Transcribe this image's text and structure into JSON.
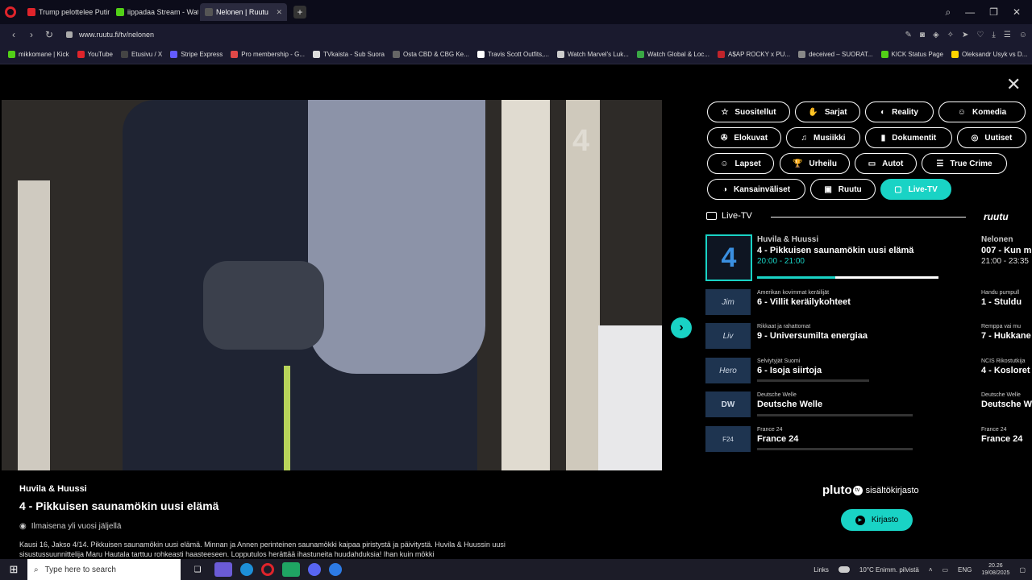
{
  "browser": {
    "tabs": [
      {
        "label": "Trump pelottelee Putinia |",
        "color": "#e0242b",
        "active": false
      },
      {
        "label": "iippadaa Stream - Watch",
        "color": "#52d017",
        "active": false
      },
      {
        "label": "Nelonen | Ruutu",
        "color": "#555555",
        "active": true
      }
    ],
    "new_tab": "+",
    "url": "www.ruutu.fi/tv/nelonen",
    "bookmarks": [
      {
        "label": "mikkomane | Kick",
        "color": "#52d017"
      },
      {
        "label": "YouTube",
        "color": "#e0242b"
      },
      {
        "label": "Etusivu / X",
        "color": "#444444"
      },
      {
        "label": "Stripe Express",
        "color": "#635bff"
      },
      {
        "label": "Pro membership - G...",
        "color": "#e04848"
      },
      {
        "label": "TVkaista - Sub Suora",
        "color": "#dddddd"
      },
      {
        "label": "Osta CBD & CBG Ke...",
        "color": "#666666"
      },
      {
        "label": "Travis Scott Outfits,...",
        "color": "#ffffff"
      },
      {
        "label": "Watch Marvel's Luk...",
        "color": "#cccccc"
      },
      {
        "label": "Watch Global & Loc...",
        "color": "#3aa845"
      },
      {
        "label": "A$AP ROCKY x PU...",
        "color": "#c0242b"
      },
      {
        "label": "deceived – SUORAT...",
        "color": "#888888"
      },
      {
        "label": "KICK Status Page",
        "color": "#52d017"
      },
      {
        "label": "Oleksandr Usyk vs D...",
        "color": "#ffd400"
      }
    ]
  },
  "player": {
    "channel_watermark": "4",
    "show": "Huvila & Huussi",
    "episode": "4 - Pikkuisen saunamökin uusi elämä",
    "availability": "Ilmaisena yli vuosi jäljellä",
    "description": "Kausi 16, Jakso 4/14. Pikkuisen saunamökin uusi elämä. Minnan ja Annen perinteinen saunamökki kaipaa piristystä ja päivitystä. Huvila & Huussin uusi sisustussuunnittelija Maru Hautala tarttuu rohkeasti haasteeseen. Lopputulos herättää ihastuneita huudahduksia! Ihan kuin mökki"
  },
  "categories": [
    {
      "label": "Suositellut",
      "icon": "☆"
    },
    {
      "label": "Sarjat",
      "icon": "✋"
    },
    {
      "label": "Reality",
      "icon": "◐"
    },
    {
      "label": "Komedia",
      "icon": "☺"
    },
    {
      "label": "Elokuvat",
      "icon": "✇"
    },
    {
      "label": "Musiikki",
      "icon": "♫"
    },
    {
      "label": "Dokumentit",
      "icon": "▮"
    },
    {
      "label": "Uutiset",
      "icon": "◎"
    },
    {
      "label": "Lapset",
      "icon": "☺"
    },
    {
      "label": "Urheilu",
      "icon": "🏆"
    },
    {
      "label": "Autot",
      "icon": "▭"
    },
    {
      "label": "True Crime",
      "icon": "☰"
    },
    {
      "label": "Kansainväliset",
      "icon": "◑"
    },
    {
      "label": "Ruutu",
      "icon": "▣"
    },
    {
      "label": "Live-TV",
      "icon": "▢"
    }
  ],
  "live": {
    "heading": "Live-TV",
    "ruutu_logo": "ruutu",
    "channels": [
      {
        "logo": "4",
        "sub": "Huvila & Huussi",
        "title": "4 - Pikkuisen saunamökin uusi elämä",
        "time": "20:00 - 21:00",
        "progress": 0.43
      },
      {
        "logo": "Jim",
        "sub": "Amerikan kovimmat keräilijät",
        "title": "6 - Villit keräilykohteet",
        "time": "",
        "progress": 0.0
      },
      {
        "logo": "Liv",
        "sub": "Rikkaat ja rahattomat",
        "title": "9 - Universumilta energiaa",
        "time": "",
        "progress": 0.0
      },
      {
        "logo": "Hero",
        "sub": "Selviytyjät Suomi",
        "title": "6 - Isoja siirtoja",
        "time": "",
        "progress": 0.0
      },
      {
        "logo": "DW",
        "sub": "Deutsche Welle",
        "title": "Deutsche Welle",
        "time": "",
        "progress": 0.0
      },
      {
        "logo": "F24",
        "sub": "France 24",
        "title": "France 24",
        "time": "",
        "progress": 0.0
      }
    ],
    "next": [
      {
        "sub": "Nelonen",
        "title": "007 - Kun m",
        "time": "21:00 - 23:35"
      },
      {
        "sub": "Handu pumpull",
        "title": "1 - Stuldu",
        "time": ""
      },
      {
        "sub": "Remppa vai mu",
        "title": "7 - Hukkane",
        "time": ""
      },
      {
        "sub": "NCIS Rikostutkija",
        "title": "4 - Kosloret",
        "time": ""
      },
      {
        "sub": "Deutsche Welle",
        "title": "Deutsche W",
        "time": ""
      },
      {
        "sub": "France 24",
        "title": "France 24",
        "time": ""
      }
    ]
  },
  "pluto": {
    "brand": "pluto",
    "tv": "tv",
    "text": "sisältökirjasto",
    "button": "Kirjasto"
  },
  "taskbar": {
    "search_placeholder": "Type here to search",
    "links": "Links",
    "weather": "10°C  Enimm. pilvistä",
    "lang": "ENG",
    "time": "20.26",
    "date": "19/08/2025"
  }
}
